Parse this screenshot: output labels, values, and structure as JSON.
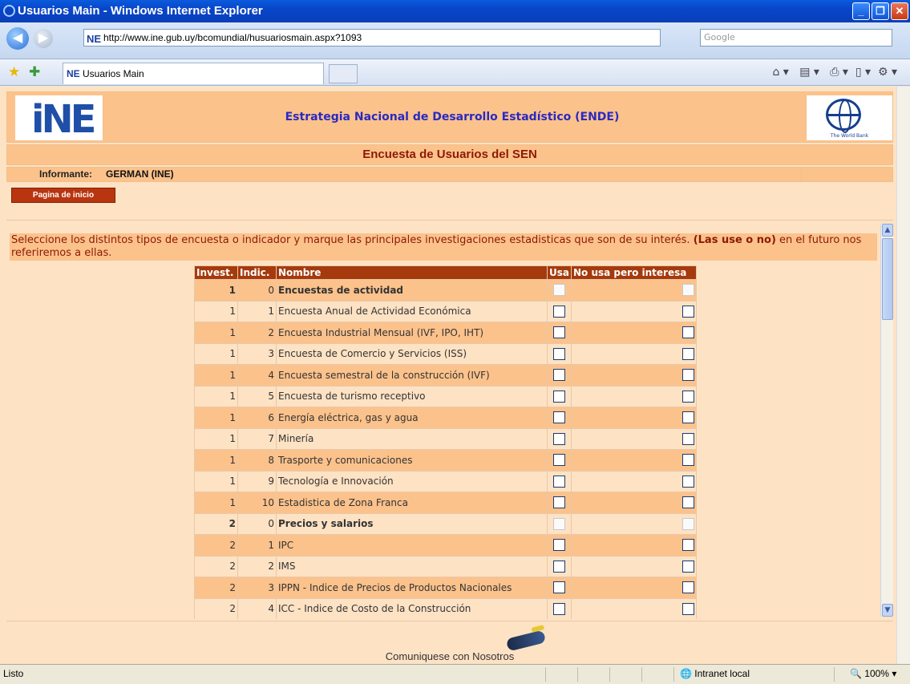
{
  "window": {
    "title": "Usuarios Main - Windows Internet Explorer",
    "controls": [
      "_",
      "❐",
      "✕"
    ]
  },
  "browser": {
    "back": "◀",
    "forward": "▶",
    "url": "http://www.ine.gub.uy/bcomundial/husuariosmain.aspx?1093",
    "search_placeholder": "Google",
    "tab_label": "Usuarios Main",
    "tab_logo": "NE",
    "url_logo": "NE",
    "status": "Listo",
    "zone": "Intranet local",
    "zoom": "100%"
  },
  "header": {
    "logo_text": "iNE",
    "title": "Estrategia Nacional de Desarrollo Estadístico (ENDE)",
    "bank_text": "The World Bank"
  },
  "subtitle": "Encuesta de Usuarios del SEN",
  "informante": {
    "label": "Informante:",
    "value": "GERMAN (INE)"
  },
  "home_button": "Pagina de inicio",
  "instructions": {
    "text": "Seleccione los distintos tipos de encuesta o indicador y marque las principales investigaciones estadisticas que son de su interés. ",
    "bold": "(Las use o no)",
    "text2": " en el futuro nos referiremos a ellas."
  },
  "table": {
    "headers": [
      "Invest.",
      "Indic.",
      "Nombre",
      "Usa",
      "No usa pero interesa"
    ],
    "rows": [
      {
        "invest": "1",
        "indic": "0",
        "nombre": "Encuestas de actividad",
        "group": true
      },
      {
        "invest": "1",
        "indic": "1",
        "nombre": "Encuesta Anual de Actividad Económica",
        "group": false
      },
      {
        "invest": "1",
        "indic": "2",
        "nombre": "Encuesta Industrial Mensual (IVF, IPO, IHT)",
        "group": false
      },
      {
        "invest": "1",
        "indic": "3",
        "nombre": "Encuesta de Comercio y Servicios (ISS)",
        "group": false
      },
      {
        "invest": "1",
        "indic": "4",
        "nombre": "Encuesta semestral de la construcción (IVF)",
        "group": false
      },
      {
        "invest": "1",
        "indic": "5",
        "nombre": "Encuesta de turismo receptivo",
        "group": false
      },
      {
        "invest": "1",
        "indic": "6",
        "nombre": "Energía eléctrica, gas y agua",
        "group": false
      },
      {
        "invest": "1",
        "indic": "7",
        "nombre": "Minería",
        "group": false
      },
      {
        "invest": "1",
        "indic": "8",
        "nombre": "Trasporte y comunicaciones",
        "group": false
      },
      {
        "invest": "1",
        "indic": "9",
        "nombre": "Tecnología e Innovación",
        "group": false
      },
      {
        "invest": "1",
        "indic": "10",
        "nombre": "Estadistica de Zona Franca",
        "group": false
      },
      {
        "invest": "2",
        "indic": "0",
        "nombre": "Precios y salarios",
        "group": true
      },
      {
        "invest": "2",
        "indic": "1",
        "nombre": "IPC",
        "group": false
      },
      {
        "invest": "2",
        "indic": "2",
        "nombre": "IMS",
        "group": false
      },
      {
        "invest": "2",
        "indic": "3",
        "nombre": "IPPN - Indice de Precios de Productos Nacionales",
        "group": false
      },
      {
        "invest": "2",
        "indic": "4",
        "nombre": "ICC - Indice de Costo de la Construcción",
        "group": false
      }
    ]
  },
  "footer": {
    "contact": "Comuniquese con Nosotros"
  }
}
